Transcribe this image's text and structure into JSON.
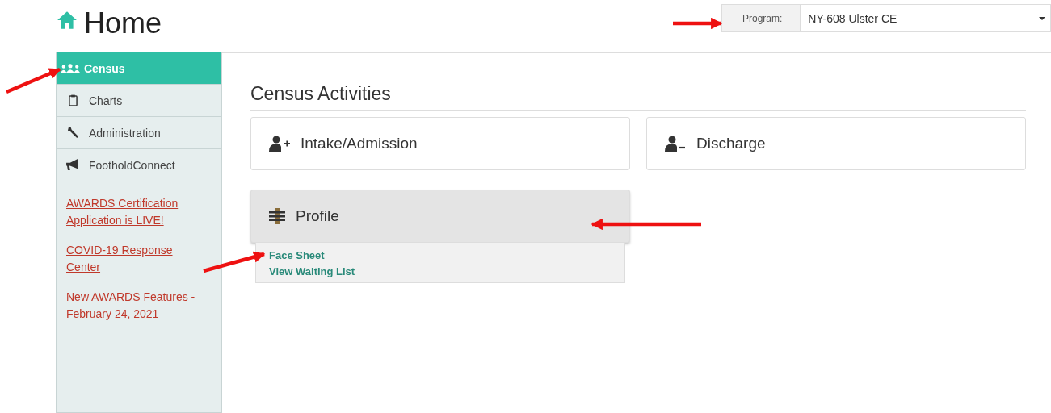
{
  "page": {
    "title": "Home"
  },
  "program": {
    "label": "Program:",
    "value": "NY-608 Ulster CE"
  },
  "sidebar": {
    "items": [
      {
        "label": "Census",
        "kind": "people",
        "selected": true
      },
      {
        "label": "Charts",
        "kind": "clipboard",
        "selected": false
      },
      {
        "label": "Administration",
        "kind": "wrench",
        "selected": false
      },
      {
        "label": "FootholdConnect",
        "kind": "megaphone",
        "selected": false
      }
    ],
    "links": [
      "AWARDS Certification Application is LIVE!",
      "COVID-19 Response Center",
      "New AWARDS Features - February 24, 2021"
    ]
  },
  "section": {
    "title": "Census Activities",
    "actions": [
      {
        "label": "Intake/Admission",
        "kind": "user-add",
        "expanded": false
      },
      {
        "label": "Discharge",
        "kind": "user-remove",
        "expanded": false
      },
      {
        "label": "Profile",
        "kind": "profile",
        "expanded": true,
        "menu": [
          "Face Sheet",
          "View Waiting List"
        ]
      }
    ]
  }
}
